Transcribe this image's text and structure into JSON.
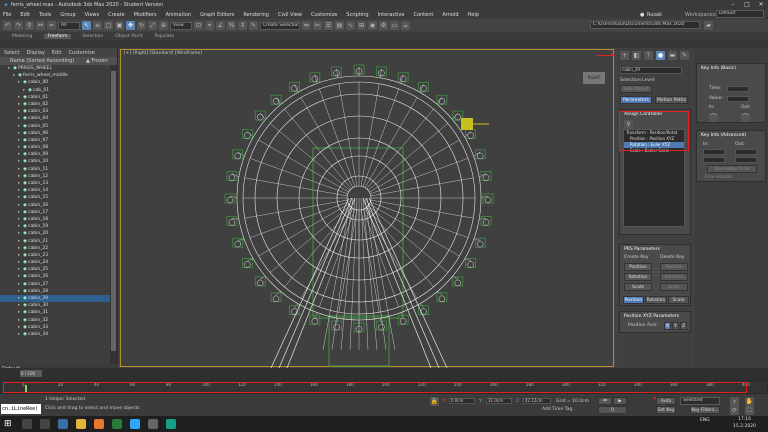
{
  "titlebar": {
    "title": "ferris_wheel.max - Autodesk 3ds Max 2020 - Student Version",
    "min": "–",
    "max": "□",
    "close": "✕"
  },
  "menu": [
    "File",
    "Edit",
    "Tools",
    "Group",
    "Views",
    "Create",
    "Modifiers",
    "Animation",
    "Graph Editors",
    "Rendering",
    "Civil View",
    "Customize",
    "Scripting",
    "Interactive",
    "Content",
    "Arnold",
    "Help"
  ],
  "user": {
    "name": "Rusak",
    "workspace_label": "Workspaces:",
    "workspace": "Default"
  },
  "toolbar": {
    "select_filter": "All",
    "view": "View",
    "selection_set": "Create Selection Se",
    "path": "C:\\Users\\Rusa\\Documents\\3ds Max 2020"
  },
  "ribbon": [
    "Modeling",
    "Freeform",
    "Selection",
    "Object Paint",
    "Populate"
  ],
  "ribbon_active": "Freeform",
  "scene": {
    "tabs": [
      "Select",
      "Display",
      "Edit",
      "Customize"
    ],
    "header": "Name (Sorted Ascending)",
    "frozen": "▲ Frozen",
    "root": [
      {
        "l": "PRISSS_WHEEL",
        "i": 1
      },
      {
        "l": "ferris_wheel_middle",
        "i": 2
      },
      {
        "l": "cabin_00",
        "i": 3
      },
      {
        "l": "cab_01",
        "i": 4
      }
    ],
    "cabins": [
      "cabin_01",
      "cabin_02",
      "cabin_03",
      "cabin_04",
      "cabin_05",
      "cabin_06",
      "cabin_07",
      "cabin_08",
      "cabin_09",
      "cabin_10",
      "cabin_11",
      "cabin_12",
      "cabin_13",
      "cabin_14",
      "cabin_15",
      "cabin_16",
      "cabin_17",
      "cabin_18",
      "cabin_19",
      "cabin_20",
      "cabin_21",
      "cabin_22",
      "cabin_23",
      "cabin_24",
      "cabin_25",
      "cabin_26",
      "cabin_27",
      "cabin_28",
      "cabin_29",
      "cabin_30",
      "cabin_31",
      "cabin_32",
      "cabin_33",
      "cabin_34"
    ],
    "highlight": "cabin_29",
    "default_label": "Default"
  },
  "viewport": {
    "label": "[+] [Right] [Standard] [Wireframe]",
    "compass": "RIGHT"
  },
  "motion": {
    "object_name": "cabin_29",
    "selection_level": "Selection Level:",
    "sub_object": "Sub-Object",
    "btn_parameters": "Parameters",
    "btn_motion_paths": "Motion Paths",
    "assign_controller": "Assign Controller",
    "controllers": [
      "Transform : Position/Rotat",
      "Position : Position XYZ",
      "Rotation : Euler XYZ",
      "Scale : Bezier Scale"
    ],
    "controller_selected": 2,
    "prs_title": "PRS Parameters",
    "create_key": "Create Key",
    "delete_key": "Delete Key",
    "prs_buttons": [
      "Position",
      "Rotation",
      "Scale"
    ],
    "prs_tabs": [
      "Position",
      "Rotation",
      "Scale"
    ],
    "posxyz_title": "Position XYZ Parameters",
    "position_axis": "Position Axis:",
    "axes": [
      "X",
      "Y",
      "Z"
    ]
  },
  "keyinfo": {
    "basic_title": "Key Info (Basic)",
    "time": "Time:",
    "value": "Value:",
    "in": "In:",
    "out": "Out:",
    "advanced_title": "Key Info (Advanced)",
    "normalize": "Normalize Time",
    "free_handle": "Free Handle"
  },
  "timeline": {
    "frame_counter": "0 / 100",
    "ticks": [
      "0",
      "10",
      "20",
      "30",
      "40",
      "50",
      "60",
      "70",
      "80",
      "90",
      "100",
      "110",
      "120",
      "130",
      "140",
      "150",
      "160",
      "170",
      "180",
      "190",
      "200",
      "210",
      "220",
      "230",
      "240",
      "250",
      "260",
      "270",
      "280",
      "290",
      "300",
      "310",
      "320",
      "330",
      "340",
      "350",
      "360",
      "370",
      "380",
      "390",
      "400"
    ]
  },
  "status": {
    "script": "cn.iLineRee(",
    "helper": "1 Helper Selected",
    "hint": "Click and drag to select and move objects",
    "x": "0.0cm",
    "y": "31.0cm",
    "z": "42.12cm",
    "grid": "Grid = 10.0cm",
    "add_time_tag": "Add Time Tag",
    "autokey": "Auto Key",
    "setkey": "Set Key",
    "selected": "Selected",
    "keyfilters": "Key Filters...",
    "frame": "0"
  },
  "taskbar": {
    "time": "17:16",
    "date": "15.2.2020",
    "lang": "ENG"
  },
  "colors": {
    "accent": "#4f7ab3",
    "wire": "#e8e8e8",
    "cabin": "#3fa83f",
    "highlight_box": "#e02020"
  }
}
